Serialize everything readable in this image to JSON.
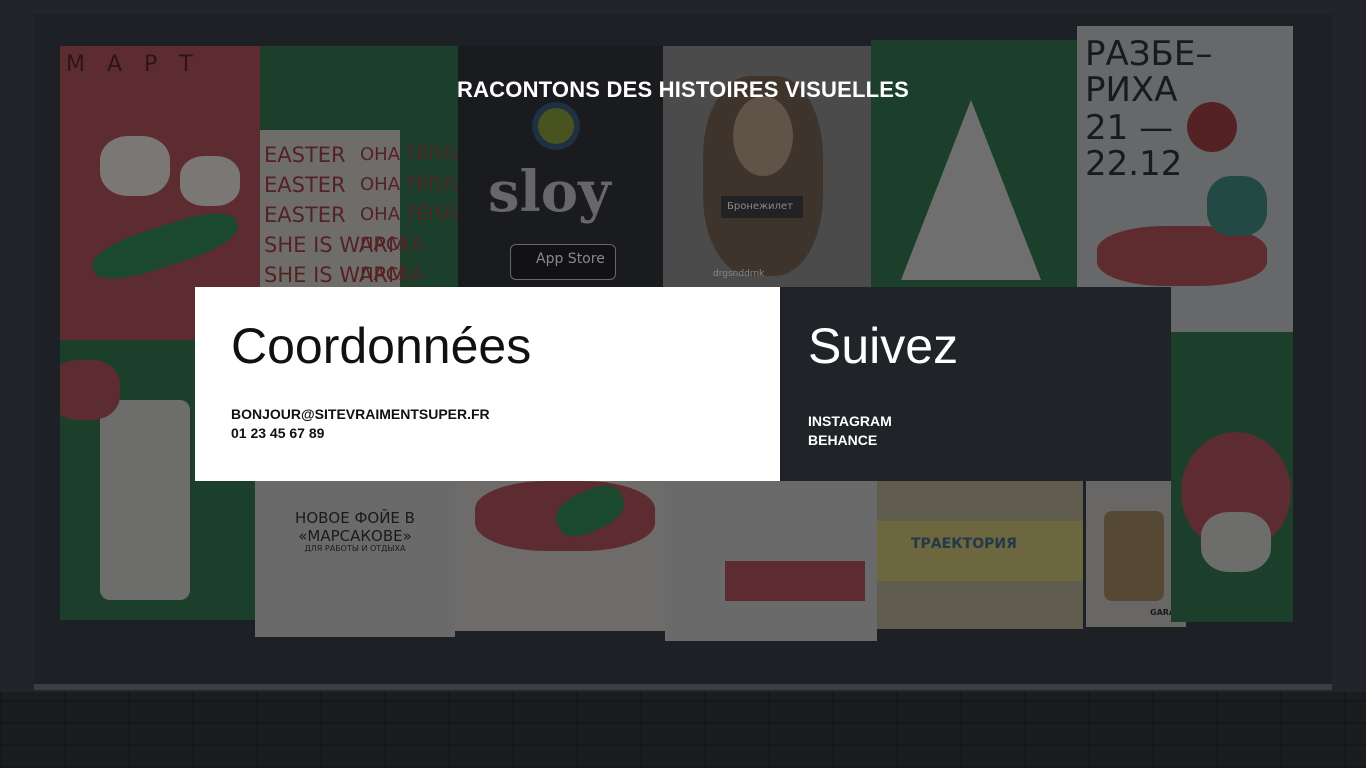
{
  "hero": {
    "headline": "RACONTONS DES HISTOIRES VISUELLES"
  },
  "contact": {
    "title": "Coordonnées",
    "email": "BONJOUR@SITEVRAIMENTSUPER.FR",
    "phone": "01 23 45 67 89"
  },
  "follow": {
    "title": "Suivez",
    "links": [
      "INSTAGRAM",
      "BEHANCE"
    ]
  },
  "background_posters": {
    "mart": "МАРТ",
    "easter_lines": [
      "EASTER",
      "EASTER",
      "EASTER",
      "SHE IS WARM",
      "SHE IS WARM"
    ],
    "ona_lines": [
      "ОНА ТЁПЛАЯ",
      "ОНА ТЁПЛАЯ",
      "ОНА ТЁПЛАЯ",
      "ПАСХА",
      "ПАСХА"
    ],
    "sloy": "sloy",
    "app_store": "App Store",
    "bronezhilet": "Бронежилет",
    "drgsnddrnk": "drgsnddrnk",
    "razberikha": "РАЗБЕ–РИХА",
    "dates": "21 — 22.12",
    "foye_title": "НОВОЕ ФОЙЕ В «МАРСАКОВЕ»",
    "foye_sub": "ДЛЯ РАБОТЫ И ОТДЫХА",
    "traektoriya": "ТРАЕКТОРИЯ",
    "garage": "GARAGE"
  },
  "colors": {
    "card_light": "#ffffff",
    "card_dark": "#202327",
    "text_dark": "#111111",
    "text_light": "#ffffff"
  }
}
